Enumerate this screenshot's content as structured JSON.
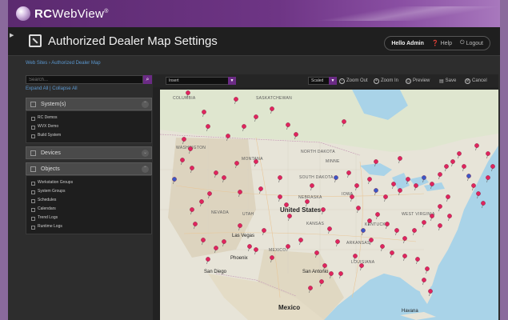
{
  "brand": {
    "name_bold": "RC",
    "name_light": "WebView",
    "mark": "®"
  },
  "title": "Authorized Dealer Map Settings",
  "user": {
    "hello": "Hello Admin",
    "help": "Help",
    "logout": "Logout"
  },
  "breadcrumb": "Web Sites › Authorized Dealer Map",
  "sidebar": {
    "search_placeholder": "Search...",
    "expand_all": "Expand All",
    "separator": "|",
    "collapse_all": "Collapse All",
    "panels": [
      {
        "title": "System(s)",
        "items": [
          "RC Demos",
          "WVX Demo",
          "Build System"
        ]
      },
      {
        "title": "Devices",
        "items": []
      },
      {
        "title": "Objects",
        "items": [
          "Workstation Groups",
          "System Groups",
          "Schedules",
          "Calendars",
          "Trend Logs",
          "Runtime Logs"
        ]
      }
    ]
  },
  "toolbar": {
    "insert": "Insert",
    "scaled": "Scaled",
    "zoom_out": "Zoom Out",
    "zoom_in": "Zoom In",
    "preview": "Preview",
    "save": "Save",
    "cancel": "Cancel"
  },
  "map": {
    "labels": {
      "columbia": "COLUMBIA",
      "saskatchewan": "SASKATCHEWAN",
      "washington": "WASHINGTON",
      "montana": "MONTANA",
      "north_dakota": "NORTH DAKOTA",
      "minne": "MINNE",
      "south_dakota": "SOUTH DAKOTA",
      "iowa": "IOWA",
      "nebraska": "NEBRASKA",
      "nevada": "NEVADA",
      "utah": "UTAH",
      "united_states": "United States",
      "kansas": "KANSAS",
      "kentucky": "KENTUCKY",
      "west_virginia": "WEST VIRGINIA",
      "las_vegas": "Las Vegas",
      "mexico_state": "MEXICO",
      "arkansas": "ARKANSAS",
      "phoenix": "Phoenix",
      "san_diego": "San Diego",
      "louisiana": "LOUISIANA",
      "san_antonio": "San Antonio",
      "mexico": "Mexico",
      "havana": "Havana"
    },
    "colors": {
      "water": "#a9d3e8",
      "land": "#e9e6dc",
      "pin": "#e0245e",
      "pin_alt": "#3a57c8"
    }
  }
}
